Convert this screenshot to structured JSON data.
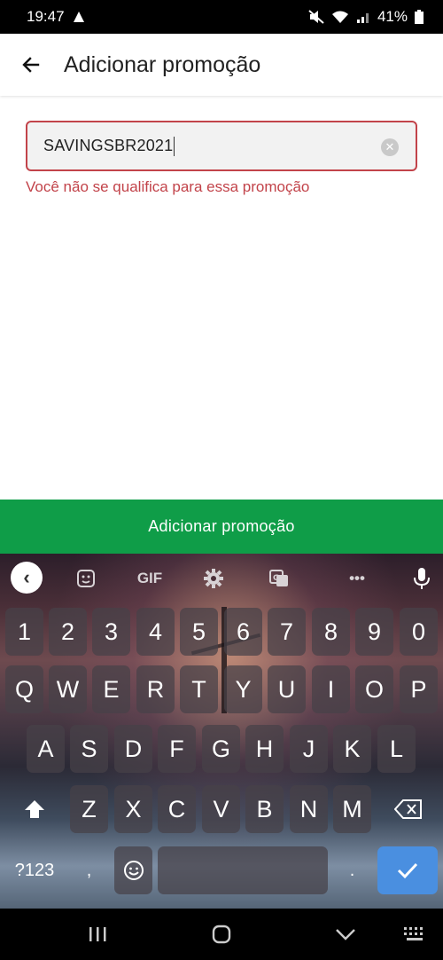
{
  "status_bar": {
    "time": "19:47",
    "battery": "41%"
  },
  "app_bar": {
    "title": "Adicionar promoção"
  },
  "promo": {
    "value": "SAVINGSBR2021",
    "error": "Você não se qualifica para essa promoção"
  },
  "action_button": {
    "label": "Adicionar promoção"
  },
  "keyboard": {
    "toolbar": {
      "gif": "GIF",
      "more": "•••"
    },
    "row_numbers": [
      "1",
      "2",
      "3",
      "4",
      "5",
      "6",
      "7",
      "8",
      "9",
      "0"
    ],
    "row_1": [
      "Q",
      "W",
      "E",
      "R",
      "T",
      "Y",
      "U",
      "I",
      "O",
      "P"
    ],
    "row_2": [
      "A",
      "S",
      "D",
      "F",
      "G",
      "H",
      "J",
      "K",
      "L"
    ],
    "row_3": [
      "Z",
      "X",
      "C",
      "V",
      "B",
      "N",
      "M"
    ],
    "symbols_key": "?123",
    "comma_key": ",",
    "period_key": "."
  }
}
